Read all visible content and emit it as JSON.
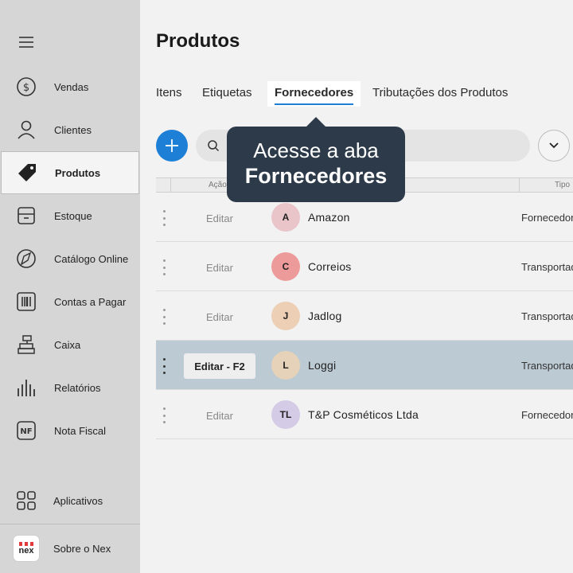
{
  "sidebar": {
    "items": [
      {
        "label": "Vendas",
        "icon": "dollar-coin-icon"
      },
      {
        "label": "Clientes",
        "icon": "person-icon"
      },
      {
        "label": "Produtos",
        "icon": "tag-icon",
        "active": true
      },
      {
        "label": "Estoque",
        "icon": "box-icon"
      },
      {
        "label": "Catálogo Online",
        "icon": "catalog-icon"
      },
      {
        "label": "Contas a Pagar",
        "icon": "barcode-icon"
      },
      {
        "label": "Caixa",
        "icon": "cash-register-icon"
      },
      {
        "label": "Relatórios",
        "icon": "bar-chart-icon"
      },
      {
        "label": "Nota Fiscal",
        "icon": "nf-icon"
      }
    ],
    "apps_label": "Aplicativos",
    "about_label": "Sobre o Nex",
    "logo_text": "nex"
  },
  "main": {
    "title": "Produtos",
    "tabs": [
      {
        "label": "Itens"
      },
      {
        "label": "Etiquetas"
      },
      {
        "label": "Fornecedores",
        "active": true
      },
      {
        "label": "Tributações dos Produtos"
      }
    ],
    "search_placeholder": "",
    "table": {
      "headers": [
        "Ação",
        "Tipo"
      ],
      "rows": [
        {
          "edit": "Editar",
          "initials": "A",
          "name": "Amazon",
          "type": "Fornecedor",
          "avatar_color": "#e9c4c8"
        },
        {
          "edit": "Editar",
          "initials": "C",
          "name": "Correios",
          "type": "Transportadora",
          "avatar_color": "#ec9a9a"
        },
        {
          "edit": "Editar",
          "initials": "J",
          "name": "Jadlog",
          "type": "Transportadora",
          "avatar_color": "#eccfb4"
        },
        {
          "edit": "Editar - F2",
          "initials": "L",
          "name": "Loggi",
          "type": "Transportadora",
          "avatar_color": "#e6d2b8",
          "highlighted": true
        },
        {
          "edit": "Editar",
          "initials": "TL",
          "name": "T&P Cosméticos Ltda",
          "type": "Fornecedor",
          "avatar_color": "#d4cbe6"
        }
      ]
    }
  },
  "tooltip": {
    "line1": "Acesse a aba",
    "line2": "Fornecedores"
  },
  "colors": {
    "accent": "#1e7fd6",
    "tooltip_bg": "#2d3a4a",
    "highlight_row": "#bccad4"
  }
}
